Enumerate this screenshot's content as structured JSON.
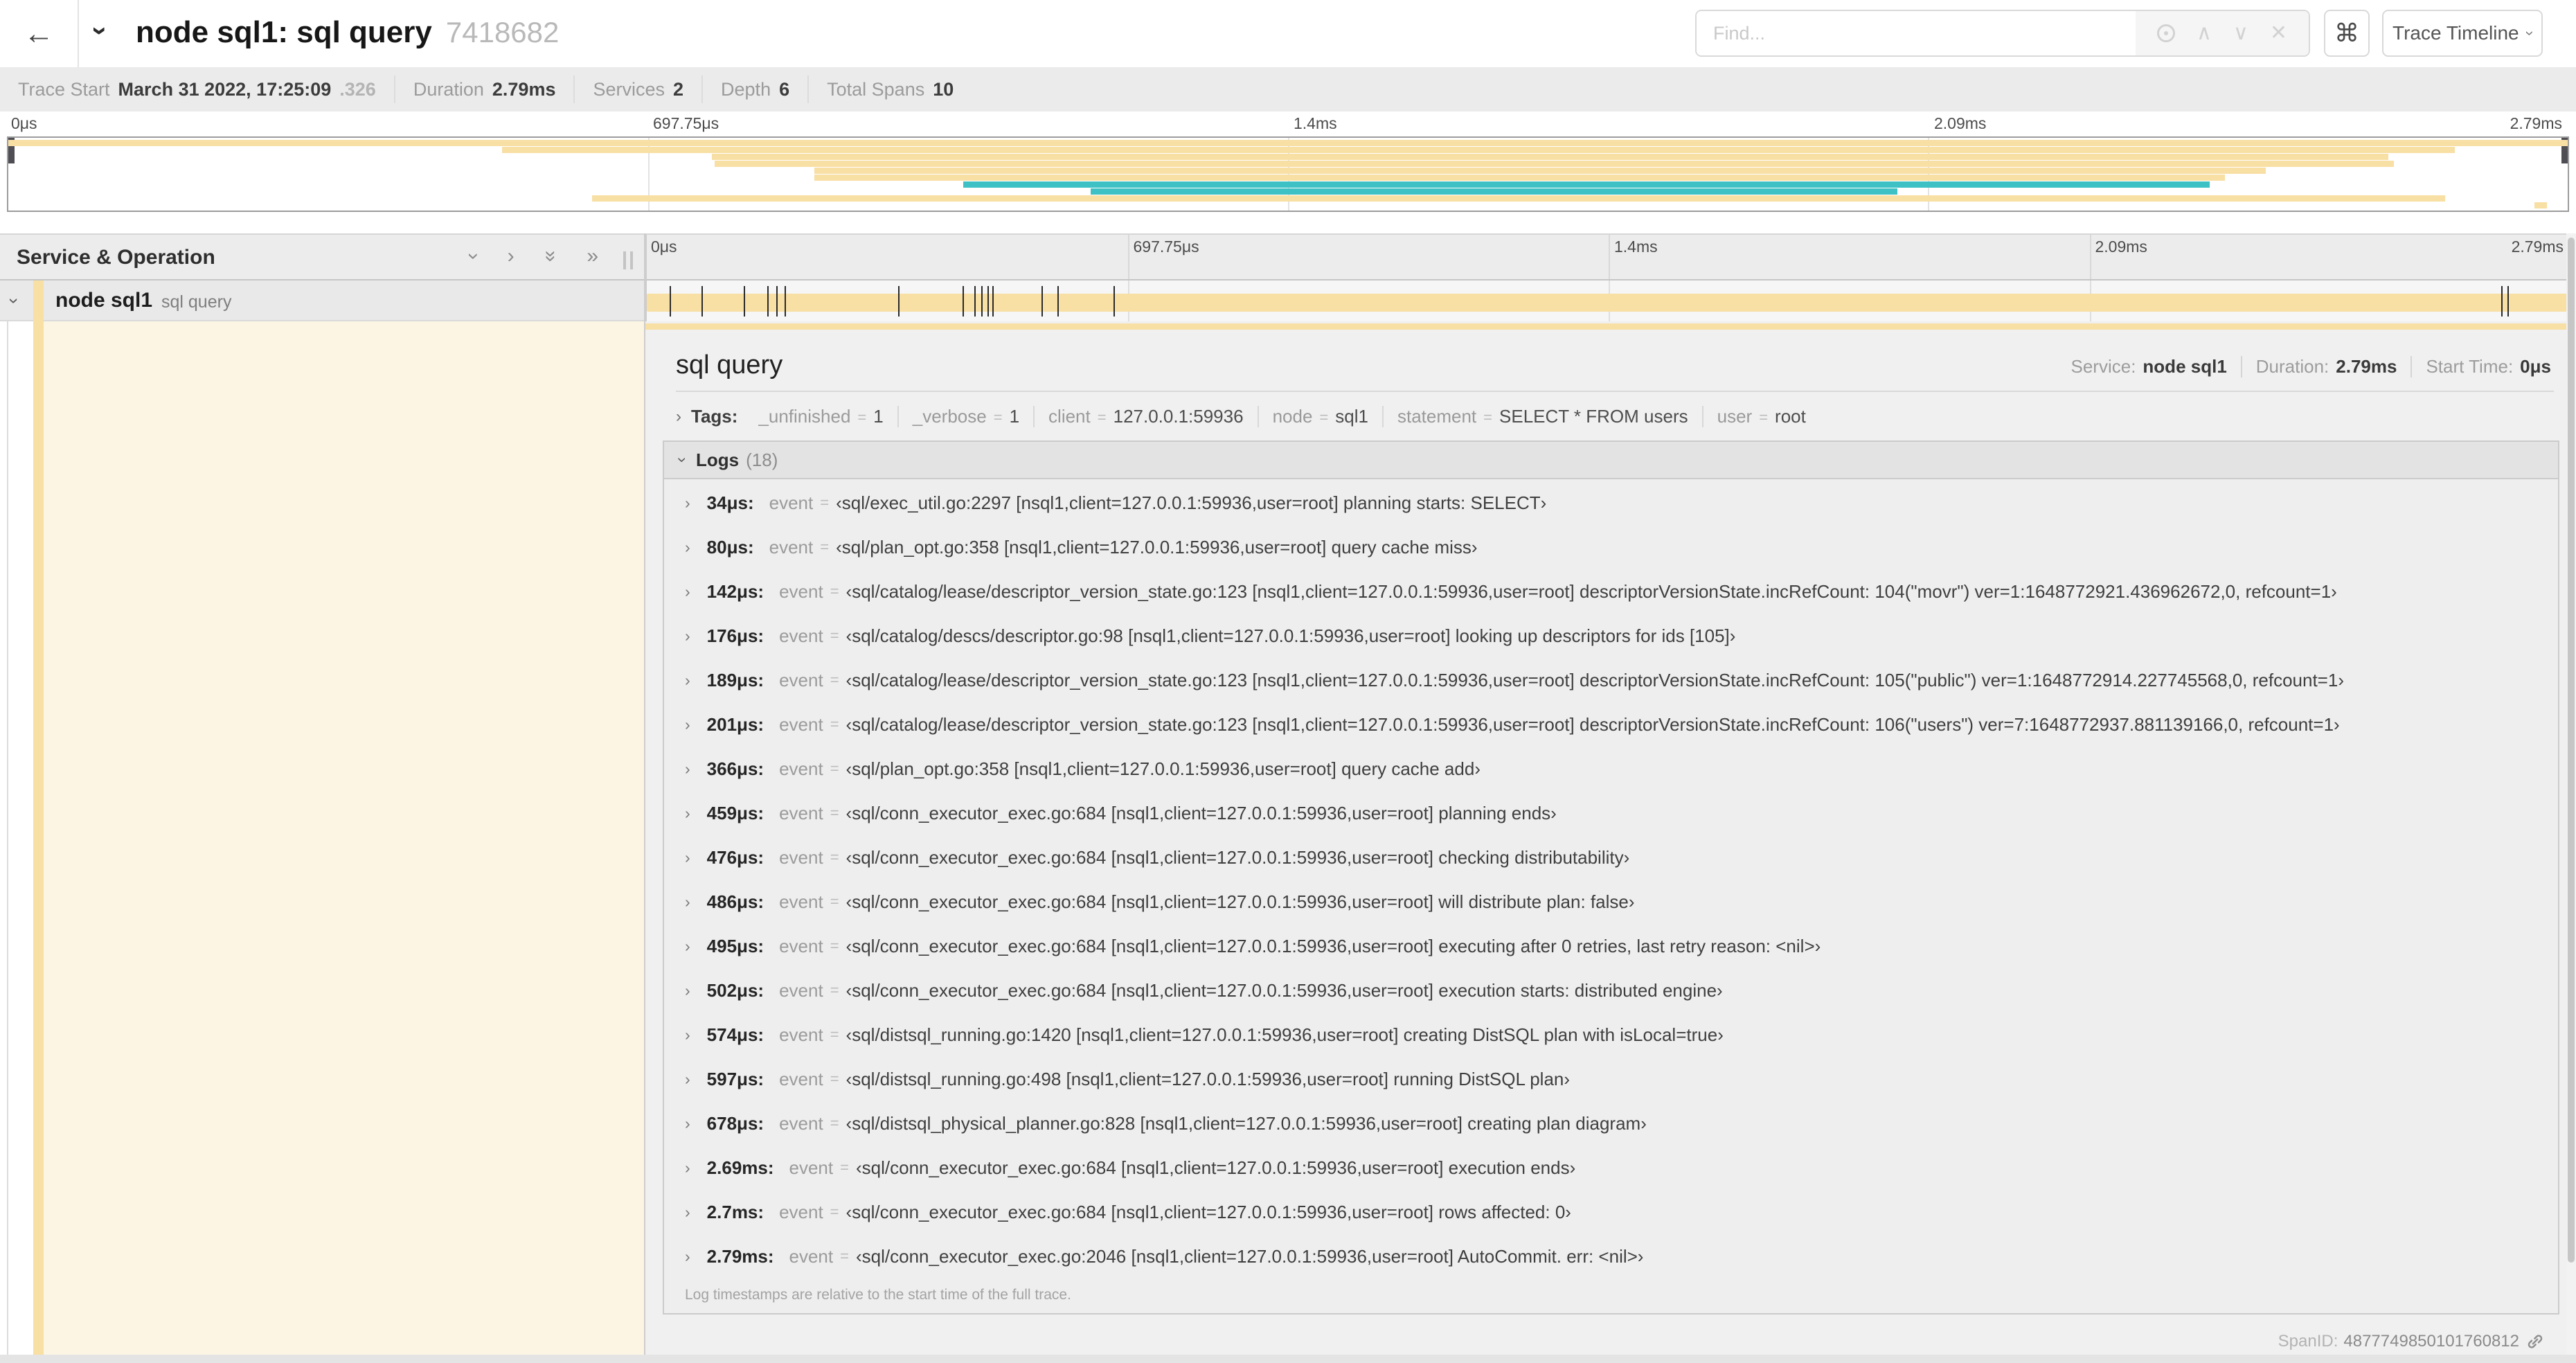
{
  "header": {
    "back_icon": "←",
    "title": "node sql1: sql query",
    "trace_id_short": "7418682",
    "find_placeholder": "Find...",
    "shortcut_key": "⌘",
    "view_options_label": "Trace Timeline"
  },
  "trace_summary": {
    "items": [
      {
        "label": "Trace Start",
        "value": "March 31 2022, 17:25:09",
        "suffix": ".326"
      },
      {
        "label": "Duration",
        "value": "2.79ms",
        "suffix": ""
      },
      {
        "label": "Services",
        "value": "2",
        "suffix": ""
      },
      {
        "label": "Depth",
        "value": "6",
        "suffix": ""
      },
      {
        "label": "Total Spans",
        "value": "10",
        "suffix": ""
      }
    ]
  },
  "ticks": [
    "0μs",
    "697.75μs",
    "1.4ms",
    "2.09ms",
    "2.79ms"
  ],
  "ticks_pct": [
    0,
    25,
    50,
    75,
    100
  ],
  "colors": {
    "tan": "#F8DFA4",
    "teal": "#3EC1C5",
    "cream": "#FCF5E4"
  },
  "minimap": {
    "rows": [
      {
        "left": 0,
        "width": 100,
        "color": "tan"
      },
      {
        "left": 19.3,
        "width": 76.3,
        "color": "tan"
      },
      {
        "left": 27.5,
        "width": 65.5,
        "color": "tan"
      },
      {
        "left": 27.6,
        "width": 65.6,
        "color": "tan"
      },
      {
        "left": 31.5,
        "width": 56.7,
        "color": "tan"
      },
      {
        "left": 31.5,
        "width": 55.1,
        "color": "tan"
      },
      {
        "left": 37.3,
        "width": 48.7,
        "color": "teal"
      },
      {
        "left": 42.3,
        "width": 31.5,
        "color": "teal"
      },
      {
        "left": 22.8,
        "width": 72.4,
        "color": "tan"
      },
      {
        "left": 98.7,
        "width": 0.5,
        "color": "tan"
      }
    ]
  },
  "timeline": {
    "left_header": "Service & Operation",
    "row": {
      "service": "node sql1",
      "operation": "sql query"
    },
    "log_marker_pcts": [
      1.22,
      2.87,
      5.09,
      6.31,
      6.78,
      7.2,
      13.12,
      16.45,
      17.06,
      17.42,
      17.74,
      18.0,
      20.57,
      21.4,
      24.3,
      96.42,
      96.77,
      99.85
    ]
  },
  "detail": {
    "title": "sql query",
    "meta": [
      {
        "label": "Service:",
        "value": "node sql1"
      },
      {
        "label": "Duration:",
        "value": "2.79ms"
      },
      {
        "label": "Start Time:",
        "value": "0μs"
      }
    ],
    "tags": {
      "label": "Tags:",
      "items": [
        {
          "key": "_unfinished",
          "value": "1"
        },
        {
          "key": "_verbose",
          "value": "1"
        },
        {
          "key": "client",
          "value": "127.0.0.1:59936"
        },
        {
          "key": "node",
          "value": "sql1"
        },
        {
          "key": "statement",
          "value": "SELECT * FROM users"
        },
        {
          "key": "user",
          "value": "root"
        }
      ]
    },
    "logs": {
      "label": "Logs",
      "count": "(18)",
      "entries": [
        {
          "time": "34μs:",
          "key": "event",
          "value": "‹sql/exec_util.go:2297 [nsql1,client=127.0.0.1:59936,user=root] planning starts: SELECT›"
        },
        {
          "time": "80μs:",
          "key": "event",
          "value": "‹sql/plan_opt.go:358 [nsql1,client=127.0.0.1:59936,user=root] query cache miss›"
        },
        {
          "time": "142μs:",
          "key": "event",
          "value": "‹sql/catalog/lease/descriptor_version_state.go:123 [nsql1,client=127.0.0.1:59936,user=root] descriptorVersionState.incRefCount: 104(\"movr\") ver=1:1648772921.436962672,0, refcount=1›"
        },
        {
          "time": "176μs:",
          "key": "event",
          "value": "‹sql/catalog/descs/descriptor.go:98 [nsql1,client=127.0.0.1:59936,user=root] looking up descriptors for ids [105]›"
        },
        {
          "time": "189μs:",
          "key": "event",
          "value": "‹sql/catalog/lease/descriptor_version_state.go:123 [nsql1,client=127.0.0.1:59936,user=root] descriptorVersionState.incRefCount: 105(\"public\") ver=1:1648772914.227745568,0, refcount=1›"
        },
        {
          "time": "201μs:",
          "key": "event",
          "value": "‹sql/catalog/lease/descriptor_version_state.go:123 [nsql1,client=127.0.0.1:59936,user=root] descriptorVersionState.incRefCount: 106(\"users\") ver=7:1648772937.881139166,0, refcount=1›"
        },
        {
          "time": "366μs:",
          "key": "event",
          "value": "‹sql/plan_opt.go:358 [nsql1,client=127.0.0.1:59936,user=root] query cache add›"
        },
        {
          "time": "459μs:",
          "key": "event",
          "value": "‹sql/conn_executor_exec.go:684 [nsql1,client=127.0.0.1:59936,user=root] planning ends›"
        },
        {
          "time": "476μs:",
          "key": "event",
          "value": "‹sql/conn_executor_exec.go:684 [nsql1,client=127.0.0.1:59936,user=root] checking distributability›"
        },
        {
          "time": "486μs:",
          "key": "event",
          "value": "‹sql/conn_executor_exec.go:684 [nsql1,client=127.0.0.1:59936,user=root] will distribute plan: false›"
        },
        {
          "time": "495μs:",
          "key": "event",
          "value": "‹sql/conn_executor_exec.go:684 [nsql1,client=127.0.0.1:59936,user=root] executing after 0 retries, last retry reason: <nil>›"
        },
        {
          "time": "502μs:",
          "key": "event",
          "value": "‹sql/conn_executor_exec.go:684 [nsql1,client=127.0.0.1:59936,user=root] execution starts: distributed engine›"
        },
        {
          "time": "574μs:",
          "key": "event",
          "value": "‹sql/distsql_running.go:1420 [nsql1,client=127.0.0.1:59936,user=root] creating DistSQL plan with isLocal=true›"
        },
        {
          "time": "597μs:",
          "key": "event",
          "value": "‹sql/distsql_running.go:498 [nsql1,client=127.0.0.1:59936,user=root] running DistSQL plan›"
        },
        {
          "time": "678μs:",
          "key": "event",
          "value": "‹sql/distsql_physical_planner.go:828 [nsql1,client=127.0.0.1:59936,user=root] creating plan diagram›"
        },
        {
          "time": "2.69ms:",
          "key": "event",
          "value": "‹sql/conn_executor_exec.go:684 [nsql1,client=127.0.0.1:59936,user=root] execution ends›"
        },
        {
          "time": "2.7ms:",
          "key": "event",
          "value": "‹sql/conn_executor_exec.go:684 [nsql1,client=127.0.0.1:59936,user=root] rows affected: 0›"
        },
        {
          "time": "2.79ms:",
          "key": "event",
          "value": "‹sql/conn_executor_exec.go:2046 [nsql1,client=127.0.0.1:59936,user=root] AutoCommit. err: <nil>›"
        }
      ],
      "footer": "Log timestamps are relative to the start time of the full trace."
    },
    "span_id": {
      "label": "SpanID:",
      "value": "4877749850101760812"
    }
  }
}
